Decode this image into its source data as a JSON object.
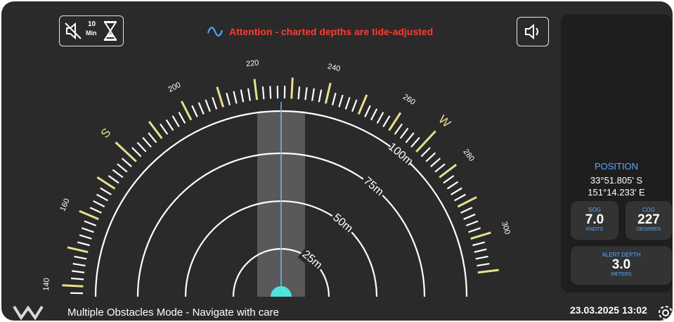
{
  "header": {
    "mute_minutes": "10",
    "mute_unit": "Min",
    "attention_text": "Attention - charted depths are tide-adjusted"
  },
  "sonar": {
    "range_labels": [
      "25m",
      "50m",
      "75m",
      "100m"
    ],
    "bearing_labels": [
      "140",
      "160",
      "S",
      "200",
      "220",
      "240",
      "260",
      "W",
      "280",
      "300"
    ],
    "heading_deg": 227
  },
  "status": {
    "mode_text": "Multiple Obstacles Mode - Navigate with care"
  },
  "sidebar": {
    "position_title": "POSITION",
    "latitude": "33°51.805' S",
    "longitude": "151°14.233' E",
    "sog": {
      "title": "SOG",
      "value": "7.0",
      "unit": "KNOTS"
    },
    "cog": {
      "title": "COG",
      "value": "227",
      "unit": "DEGREES"
    },
    "alert_depth": {
      "title": "ALERT DEPTH",
      "value": "3.0",
      "unit": "METERS"
    }
  },
  "footer": {
    "datetime": "23.03.2025 13:02"
  },
  "colors": {
    "background": "#2a2a2a",
    "alert_red": "#ff3b30",
    "accent_blue": "#5aa8ff",
    "tick_yellow": "#e8e08c",
    "vessel_cyan": "#4fe3e0"
  },
  "icons": {
    "mute_timer": "speaker-muted-hourglass-icon",
    "sound": "speaker-icon",
    "attention": "wave-icon",
    "settings": "gear-icon",
    "logo": "brand-logo-icon"
  }
}
